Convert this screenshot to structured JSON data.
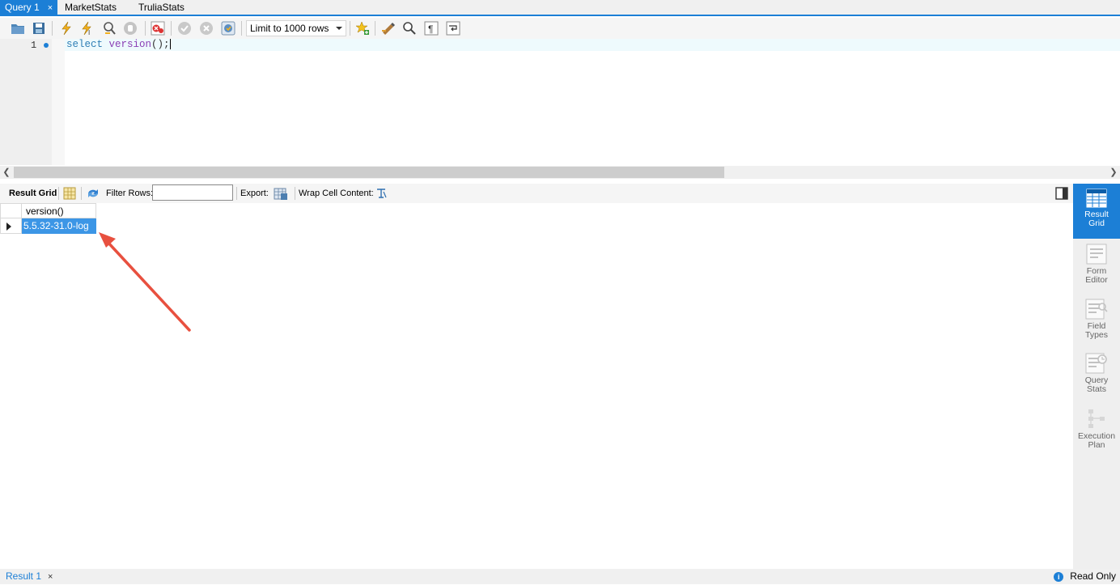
{
  "tabs": [
    {
      "label": "Query 1",
      "close": "×",
      "active": true
    },
    {
      "label": "MarketStats",
      "active": false
    },
    {
      "label": "TruliaStats",
      "active": false
    }
  ],
  "toolbar": {
    "icons": [
      "open-folder-icon",
      "save-icon",
      "execute-icon",
      "execute-current-icon",
      "explain-icon",
      "stop-icon",
      "toggle-error-icon",
      "commit-icon",
      "rollback-icon",
      "autocommit-icon",
      "add-snippet-icon",
      "beautify-icon",
      "find-icon",
      "invisible-chars-icon",
      "word-wrap-icon"
    ],
    "limit_select": "Limit to 1000 rows"
  },
  "editor": {
    "line_number": "1",
    "code": {
      "keyword": "select",
      "function": "version",
      "punct": "();"
    }
  },
  "result_toolbar": {
    "result_grid_label": "Result Grid",
    "filter_rows_label": "Filter Rows:",
    "filter_value": "",
    "export_label": "Export:",
    "wrap_label": "Wrap Cell Content:"
  },
  "grid": {
    "columns": [
      "version()"
    ],
    "rows": [
      [
        "5.5.32-31.0-log"
      ]
    ]
  },
  "side_panel": [
    {
      "line1": "Result",
      "line2": "Grid",
      "active": true
    },
    {
      "line1": "Form",
      "line2": "Editor",
      "active": false
    },
    {
      "line1": "Field",
      "line2": "Types",
      "active": false
    },
    {
      "line1": "Query",
      "line2": "Stats",
      "active": false
    },
    {
      "line1": "Execution",
      "line2": "Plan",
      "active": false
    }
  ],
  "bottom": {
    "result_tab": "Result 1",
    "close": "×",
    "status": "Read Only"
  },
  "colors": {
    "accent": "#1c7fd6",
    "selection": "#3c96e6",
    "annotation_arrow": "#e8503f"
  }
}
